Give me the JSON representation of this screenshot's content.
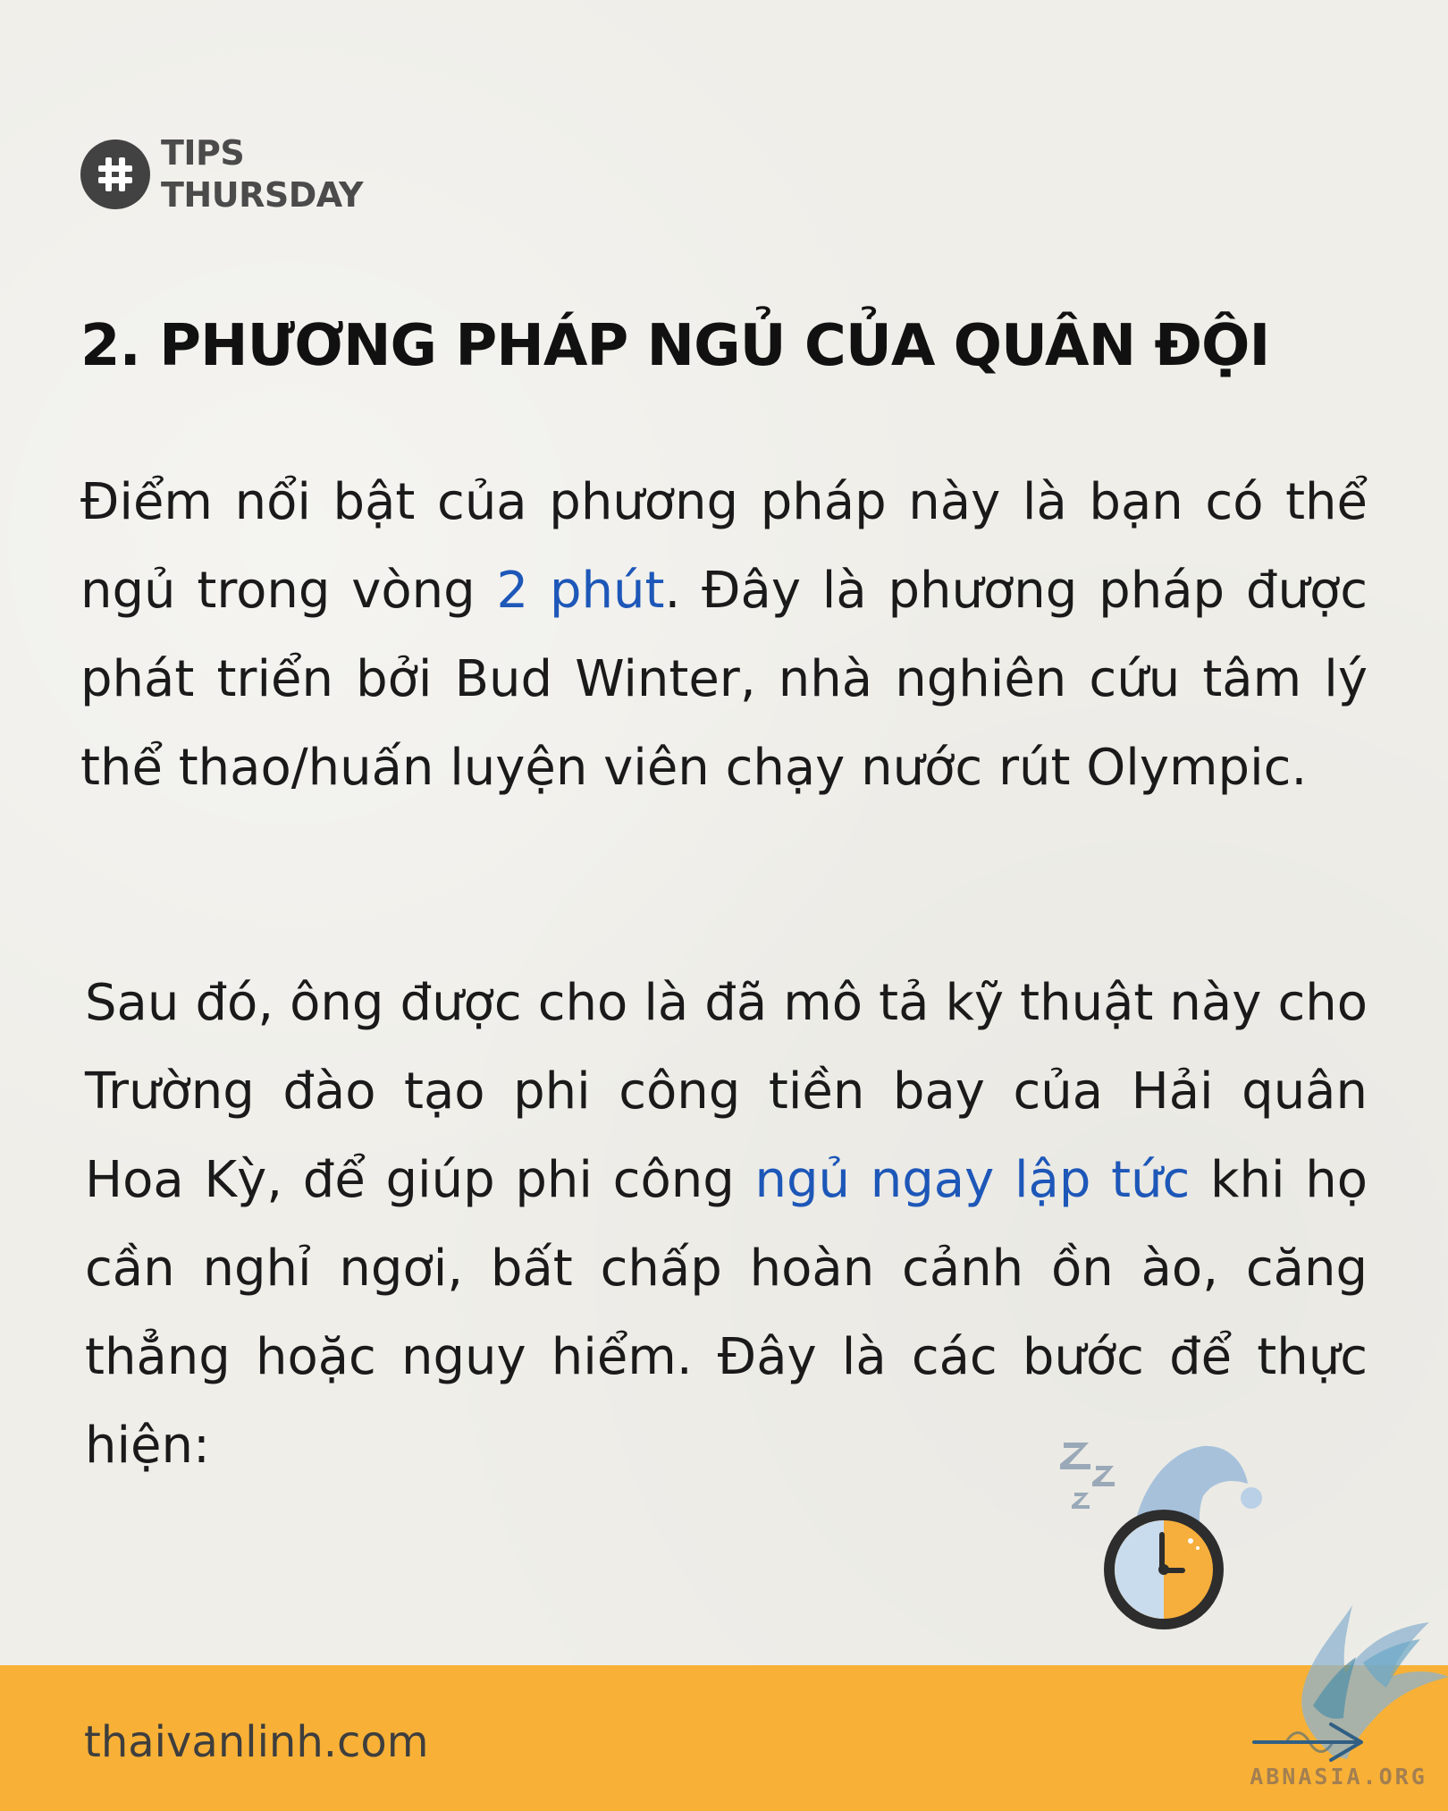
{
  "brand": {
    "line1": "TIPS",
    "line2": "THURSDAY",
    "icon": "hash-icon"
  },
  "headline": "2. PHƯƠNG PHÁP NGỦ CỦA QUÂN ĐỘI",
  "paragraph1": {
    "part1": "Điểm nổi bật của phương pháp này là bạn có thể ngủ trong vòng ",
    "highlight": "2 phút",
    "part2": ". Đây là phương pháp được phát triển bởi Bud Winter, nhà nghiên cứu tâm lý thể thao/huấn luyện viên chạy nước rút Olympic."
  },
  "paragraph2": {
    "part1": "Sau đó, ông được cho là đã mô tả kỹ thuật này cho Trường đào tạo phi công tiền bay của Hải quân Hoa Kỳ, để giúp phi công ",
    "highlight": "ngủ ngay lập tức",
    "part2": " khi họ cần nghỉ ngơi, bất chấp hoàn cảnh ồn ào, căng thẳng hoặc nguy hiểm. Đây là các bước để thực hiện:"
  },
  "footer": {
    "url": "thaivanlinh.com",
    "watermark": "ABNASIA.ORG",
    "arrow_icon": "right-arrow-icon"
  },
  "illustration": {
    "icon": "sleeping-clock-icon",
    "zzz_icon": "zzz-icon"
  },
  "colors": {
    "background": "#efeee9",
    "highlight": "#1d57b8",
    "footer": "#f8b136",
    "badge": "#424242",
    "clock_orange": "#f6ae3c",
    "clock_blue": "#c9dced",
    "cap_blue": "#a7c1db"
  }
}
